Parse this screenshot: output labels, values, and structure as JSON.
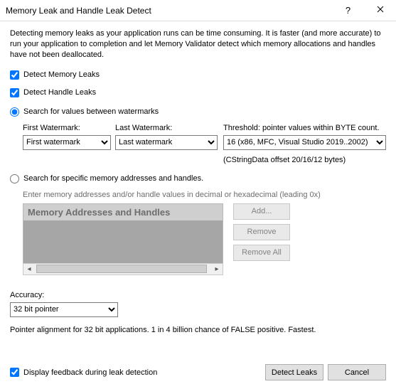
{
  "titlebar": {
    "title": "Memory Leak and Handle Leak Detect",
    "help_symbol": "?",
    "close_label": "Close"
  },
  "intro": "Detecting memory leaks as your application runs can be time consuming. It is faster (and more accurate) to run your application to completion and let Memory Validator detect which memory allocations and handles have not been deallocated.",
  "checks": {
    "memory_leaks": "Detect Memory Leaks",
    "handle_leaks": "Detect Handle Leaks"
  },
  "radio": {
    "watermarks": "Search for values between watermarks",
    "specific": "Search for specific memory addresses and handles."
  },
  "watermark": {
    "first_label": "First Watermark:",
    "last_label": "Last Watermark:",
    "threshold_label": "Threshold: pointer values within BYTE count.",
    "first_value": "First watermark",
    "last_value": "Last watermark",
    "threshold_value": "16 (x86, MFC, Visual Studio 2019..2002)",
    "offset_note": "(CStringData offset 20/16/12 bytes)"
  },
  "addresses": {
    "hint": "Enter memory addresses and/or handle values in decimal or hexadecimal (leading 0x)",
    "panel_title": "Memory Addresses and Handles",
    "add_label": "Add...",
    "remove_label": "Remove",
    "remove_all_label": "Remove All"
  },
  "accuracy": {
    "label": "Accuracy:",
    "value": "32 bit pointer",
    "note": "Pointer alignment for 32 bit applications. 1 in 4 billion chance of FALSE positive. Fastest."
  },
  "footer": {
    "feedback_label": "Display feedback during leak detection",
    "detect_label": "Detect Leaks",
    "cancel_label": "Cancel"
  }
}
